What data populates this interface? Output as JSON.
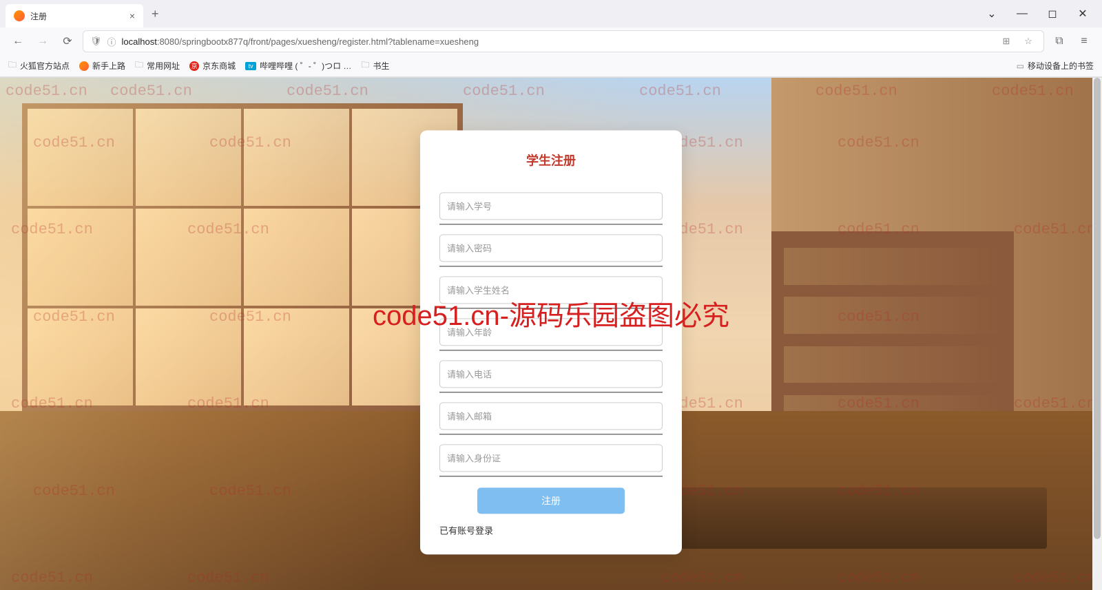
{
  "browser": {
    "tab_title": "注册",
    "url_host": "localhost",
    "url_port_path": ":8080/springbootx877q/front/pages/xuesheng/register.html?tablename=xuesheng"
  },
  "bookmarks": {
    "firefox_official": "火狐官方站点",
    "newbie": "新手上路",
    "common_sites": "常用网址",
    "jd": "京东商城",
    "bilibili": "哔哩哔哩 (  ゜- ゜)つロ …",
    "shusheng": "书生",
    "mobile": "移动设备上的书签"
  },
  "form": {
    "title": "学生注册",
    "fields": [
      {
        "placeholder": "请输入学号"
      },
      {
        "placeholder": "请输入密码"
      },
      {
        "placeholder": "请输入学生姓名"
      },
      {
        "placeholder": "请输入年龄"
      },
      {
        "placeholder": "请输入电话"
      },
      {
        "placeholder": "请输入邮箱"
      },
      {
        "placeholder": "请输入身份证"
      }
    ],
    "submit": "注册",
    "login_link": "已有账号登录"
  },
  "watermark": {
    "small": "code51.cn",
    "big": "code51.cn-源码乐园盗图必究"
  }
}
